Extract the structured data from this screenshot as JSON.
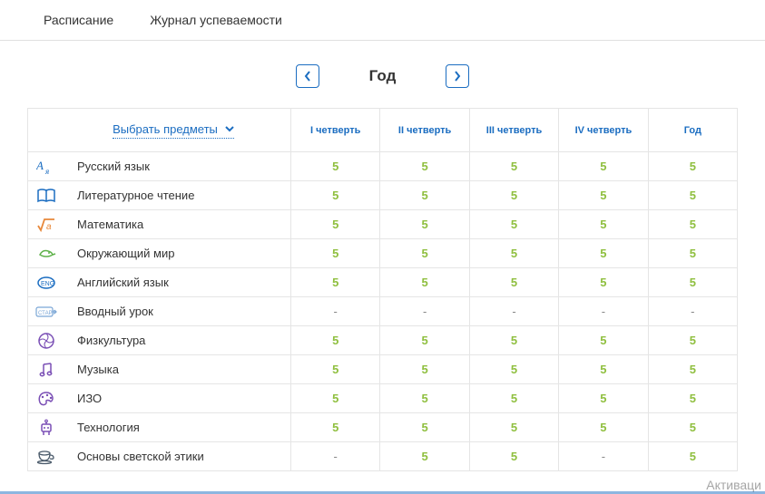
{
  "nav": {
    "schedule": "Расписание",
    "gradebook": "Журнал успеваемости"
  },
  "period": {
    "title": "Год"
  },
  "table": {
    "select_subjects": "Выбрать предметы",
    "columns": [
      "I четверть",
      "II четверть",
      "III четверть",
      "IV четверть",
      "Год"
    ],
    "rows": [
      {
        "subject": "Русский язык",
        "icon": "letters",
        "icon_color": "#1b6dc1",
        "grades": [
          "5",
          "5",
          "5",
          "5",
          "5"
        ]
      },
      {
        "subject": "Литературное чтение",
        "icon": "book",
        "icon_color": "#1b6dc1",
        "grades": [
          "5",
          "5",
          "5",
          "5",
          "5"
        ]
      },
      {
        "subject": "Математика",
        "icon": "sqrt",
        "icon_color": "#e8883a",
        "grades": [
          "5",
          "5",
          "5",
          "5",
          "5"
        ]
      },
      {
        "subject": "Окружающий мир",
        "icon": "bird",
        "icon_color": "#5fb24a",
        "grades": [
          "5",
          "5",
          "5",
          "5",
          "5"
        ]
      },
      {
        "subject": "Английский язык",
        "icon": "eng",
        "icon_color": "#1b6dc1",
        "grades": [
          "5",
          "5",
          "5",
          "5",
          "5"
        ]
      },
      {
        "subject": "Вводный урок",
        "icon": "start",
        "icon_color": "#7aa6d6",
        "grades": [
          "-",
          "-",
          "-",
          "-",
          "-"
        ]
      },
      {
        "subject": "Физкультура",
        "icon": "ball",
        "icon_color": "#7a4fb5",
        "grades": [
          "5",
          "5",
          "5",
          "5",
          "5"
        ]
      },
      {
        "subject": "Музыка",
        "icon": "music",
        "icon_color": "#7a4fb5",
        "grades": [
          "5",
          "5",
          "5",
          "5",
          "5"
        ]
      },
      {
        "subject": "ИЗО",
        "icon": "palette",
        "icon_color": "#7a4fb5",
        "grades": [
          "5",
          "5",
          "5",
          "5",
          "5"
        ]
      },
      {
        "subject": "Технология",
        "icon": "robot",
        "icon_color": "#7a4fb5",
        "grades": [
          "5",
          "5",
          "5",
          "5",
          "5"
        ]
      },
      {
        "subject": "Основы светской этики",
        "icon": "cup",
        "icon_color": "#4a5a6a",
        "grades": [
          "-",
          "5",
          "5",
          "-",
          "5"
        ]
      }
    ]
  },
  "watermark": "Активаци"
}
